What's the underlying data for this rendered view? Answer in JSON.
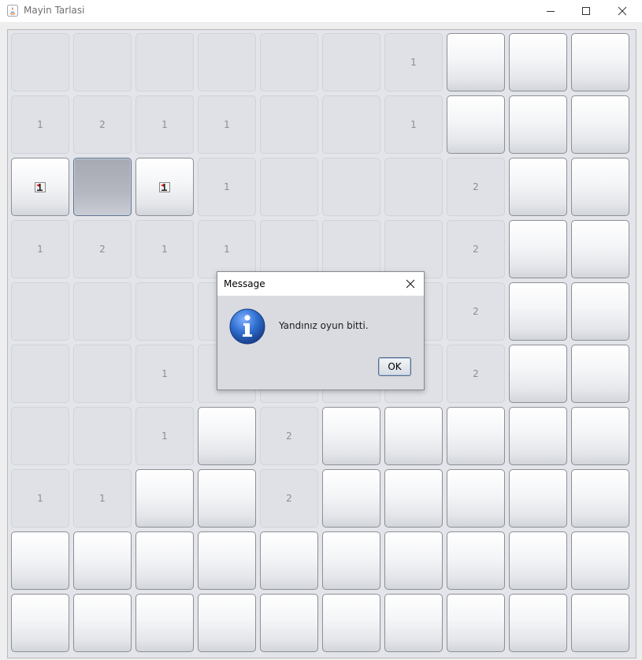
{
  "window": {
    "title": "Mayin Tarlasi",
    "minimize_icon": "minimize-icon",
    "maximize_icon": "maximize-icon",
    "close_icon": "close-icon"
  },
  "board": {
    "rows": 10,
    "cols": 10,
    "cells": [
      [
        "o",
        "o",
        "o",
        "o",
        "o",
        "o",
        "1",
        "c",
        "c",
        "c"
      ],
      [
        "1",
        "2",
        "1",
        "1",
        "o",
        "o",
        "1",
        "c",
        "c",
        "c"
      ],
      [
        "f",
        "p",
        "f",
        "1",
        "o",
        "o",
        "o",
        "2",
        "c",
        "c"
      ],
      [
        "1",
        "2",
        "1",
        "1",
        "o",
        "o",
        "o",
        "2",
        "c",
        "c"
      ],
      [
        "o",
        "o",
        "o",
        "o",
        "o",
        "o",
        "o",
        "2",
        "c",
        "c"
      ],
      [
        "o",
        "o",
        "1",
        "o",
        "o",
        "o",
        "o",
        "2",
        "c",
        "c"
      ],
      [
        "o",
        "o",
        "1",
        "c",
        "2",
        "c",
        "c",
        "c",
        "c",
        "c"
      ],
      [
        "1",
        "1",
        "c",
        "c",
        "2",
        "c",
        "c",
        "c",
        "c",
        "c"
      ],
      [
        "c",
        "c",
        "c",
        "c",
        "c",
        "c",
        "c",
        "c",
        "c",
        "c"
      ],
      [
        "c",
        "c",
        "c",
        "c",
        "c",
        "c",
        "c",
        "c",
        "c",
        "c"
      ]
    ],
    "legend": {
      "o": "opened-empty",
      "c": "closed",
      "f": "flagged",
      "p": "pressed"
    },
    "flag_icon": "flag-icon"
  },
  "dialog": {
    "title": "Message",
    "message": "Yandınız oyun bitti.",
    "ok_label": "OK",
    "icon": "info-icon",
    "close_icon": "close-icon"
  },
  "colors": {
    "info_blue": "#2f6fd0",
    "number_gray": "#8d8d8d",
    "flag_red": "#d81e1e"
  }
}
